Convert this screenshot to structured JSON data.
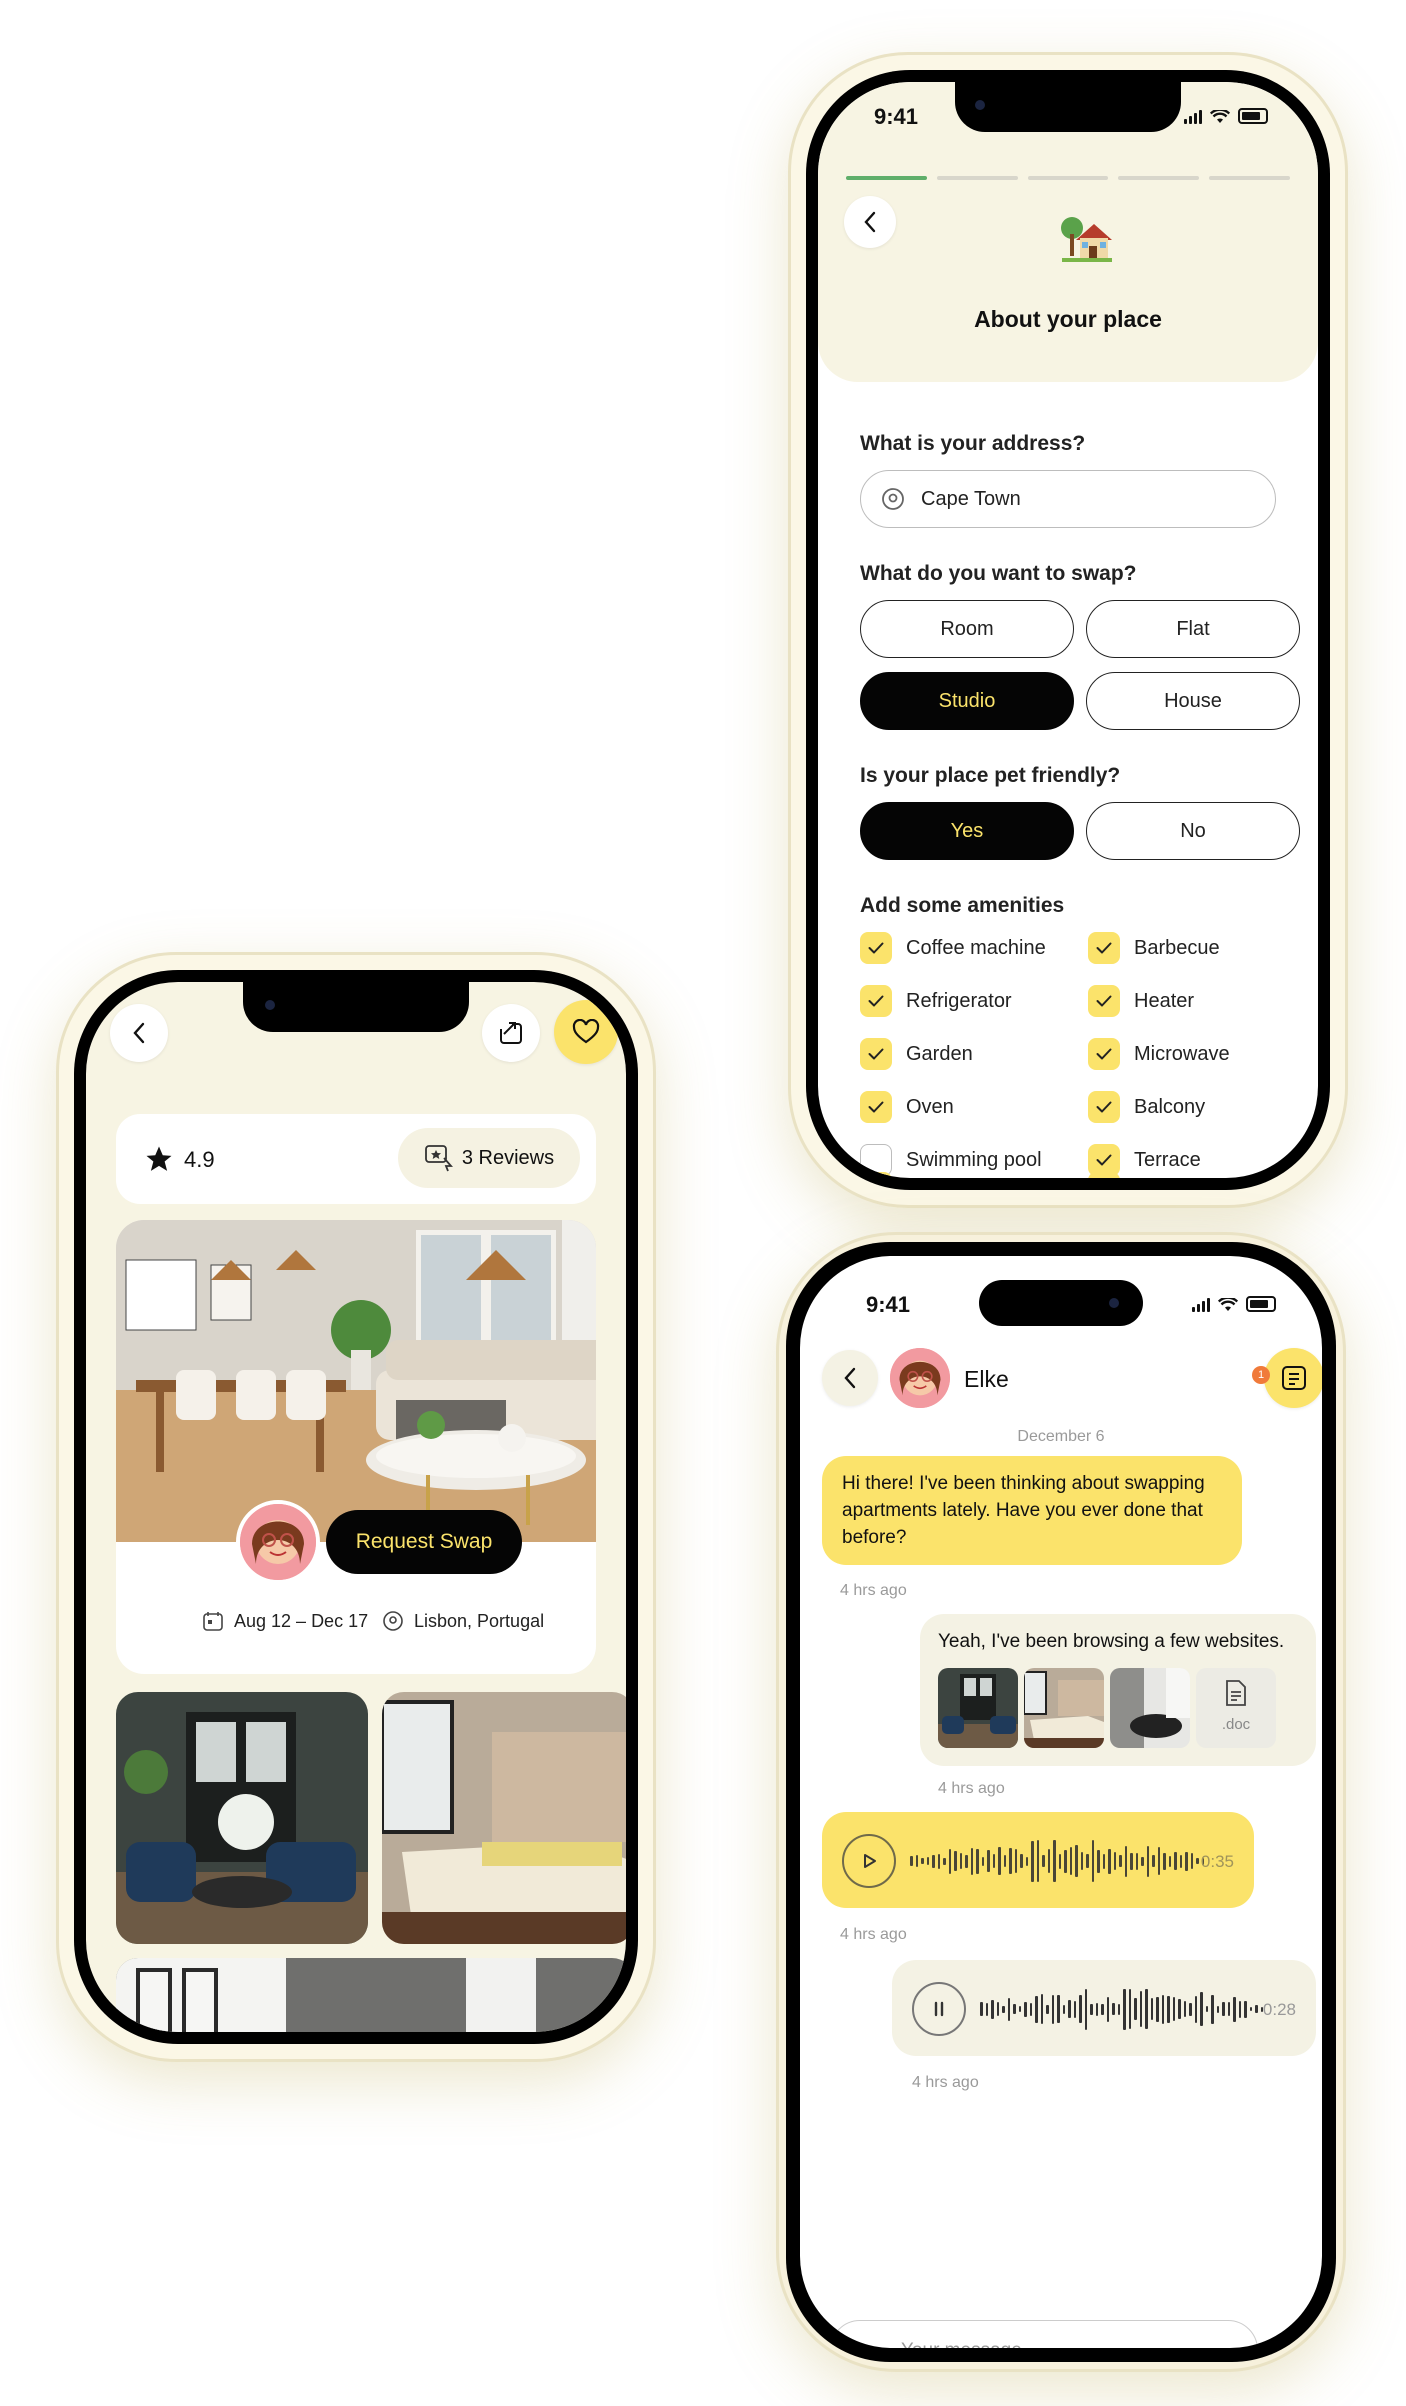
{
  "form": {
    "status_time": "9:41",
    "title": "About your place",
    "address_label": "What is your address?",
    "address_value": "Cape Town",
    "swap_label": "What do you want to swap?",
    "swap_options": [
      "Room",
      "Flat",
      "Studio",
      "House"
    ],
    "swap_selected": "Studio",
    "pet_label": "Is your place pet friendly?",
    "pet_options": [
      "Yes",
      "No"
    ],
    "pet_selected": "Yes",
    "amenities_label": "Add some amenities",
    "amenities": [
      {
        "label": "Coffee machine",
        "checked": true
      },
      {
        "label": "Barbecue",
        "checked": true
      },
      {
        "label": "Refrigerator",
        "checked": true
      },
      {
        "label": "Heater",
        "checked": true
      },
      {
        "label": "Garden",
        "checked": true
      },
      {
        "label": "Microwave",
        "checked": true
      },
      {
        "label": "Oven",
        "checked": true
      },
      {
        "label": "Balcony",
        "checked": true
      },
      {
        "label": "Swimming pool",
        "checked": false
      },
      {
        "label": "Terrace",
        "checked": true
      }
    ]
  },
  "listing": {
    "rating": "4.9",
    "reviews": "3 Reviews",
    "request_button": "Request Swap",
    "dates": "Aug 12 – Dec 17",
    "location": "Lisbon, Portugal"
  },
  "chat": {
    "status_time": "9:41",
    "contact_name": "Elke",
    "notification_count": "1",
    "date_divider": "December 6",
    "messages": [
      {
        "text": "Hi there! I've been thinking about swapping apartments lately. Have you ever done that before?",
        "time": "4 hrs ago"
      },
      {
        "text": "Yeah, I've been browsing a few websites.",
        "time": "4 hrs ago",
        "file_label": ".doc"
      },
      {
        "duration": "0:35",
        "time": "4 hrs ago"
      },
      {
        "duration": "0:28",
        "time": "4 hrs ago"
      }
    ],
    "composer_placeholder": "Your message"
  },
  "colors": {
    "accent_yellow": "#fbe36b",
    "cream": "#f7f4e3",
    "black": "#050505",
    "progress_green": "#5fae6a"
  }
}
